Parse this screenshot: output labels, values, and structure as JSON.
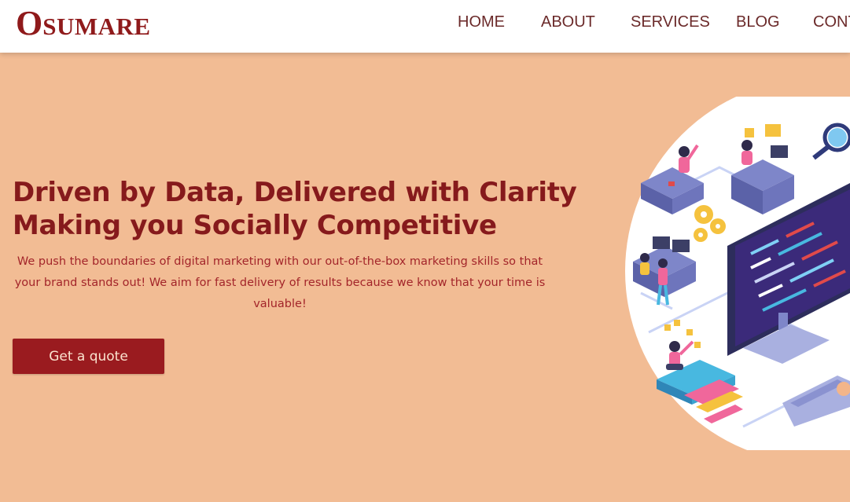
{
  "brand": {
    "logo_cap": "O",
    "logo_rest": "SUMARE"
  },
  "nav": {
    "home": "HOME",
    "about": "ABOUT",
    "services": "SERVICES",
    "blog": "BLOG",
    "contact": "CONT"
  },
  "hero": {
    "title_line1": "Driven by Data, Delivered with Clarity",
    "title_line2": "Making you Socially Competitive",
    "description": "We push the boundaries of digital marketing with our out-of-the-box marketing skills so that your brand stands out! We aim for fast delivery of results because we know that your time is valuable!",
    "cta_label": "Get a quote"
  },
  "colors": {
    "background": "#F2BC94",
    "brand": "#8F1A1B",
    "button": "#9A1B1F",
    "nav_text": "#6B2A2A"
  },
  "illustration": {
    "icon": "digital-workspace-illustration"
  }
}
